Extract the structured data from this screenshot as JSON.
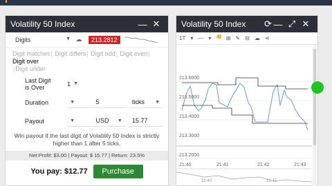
{
  "trade": {
    "title": "Volatility 50 Index",
    "underlying": "Digits",
    "spot": "213.2812",
    "tabs": [
      "Digit matches",
      "Digit differs",
      "Digit odd",
      "Digit even",
      "Digit over",
      "Digit under"
    ],
    "active_tab_index": 4,
    "last_digit_label": "Last Digit is Over",
    "last_digit_value": "1",
    "duration_label": "Duration",
    "duration_value": "5",
    "duration_unit": "ticks",
    "payout_label": "Payout",
    "currency": "USD",
    "payout_value": "15.77",
    "note": "Win payout if the last digit of Volatility 50 Index is strictly higher than 1 after 5 ticks.",
    "stats": "Net Profit: $3.00 | Payout: $ 15.77 | Return: 23.5%",
    "you_pay": "You pay: $12.77",
    "purchase_label": "Purchase"
  },
  "chart": {
    "title": "Volatility 50 Index",
    "timeframe": "1T",
    "indicator_count": "1",
    "y_ticks": [
      "213.6000",
      "213.5000",
      "213.4000",
      "213.3000",
      "213.2000"
    ],
    "x_ticks": [
      "21:40",
      "21:41",
      "21:42",
      "21:43"
    ],
    "nav_ticks": [
      "21:40",
      "21:42"
    ],
    "line_color": "#6a9ec9",
    "level_color": "#333333"
  },
  "colors": {
    "titlebar": "#2b2f38",
    "spot_bg": "#c62828",
    "purchase_bg": "#2e8836"
  }
}
